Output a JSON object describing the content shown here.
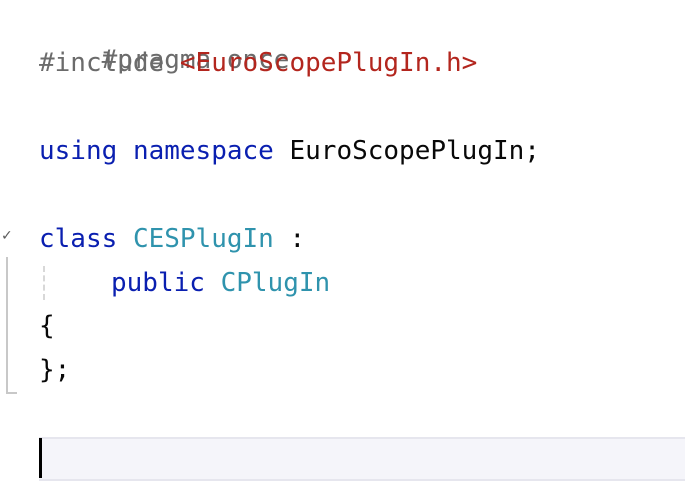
{
  "editor": {
    "lines": [
      {
        "segments": [
          {
            "text": "#pragma once"
          }
        ]
      },
      {
        "segments": [
          {
            "text": "#include "
          },
          {
            "text": "<EuroScopePlugIn.h>"
          }
        ]
      },
      {
        "segments": [
          {
            "text": "using"
          },
          {
            "text": " "
          },
          {
            "text": "namespace"
          },
          {
            "text": " EuroScopePlugIn;"
          }
        ]
      },
      {
        "segments": [
          {
            "text": "class"
          },
          {
            "text": " "
          },
          {
            "text": "CESPlugIn"
          },
          {
            "text": " :"
          }
        ]
      },
      {
        "segments": [
          {
            "text": "public"
          },
          {
            "text": " "
          },
          {
            "text": "CPlugIn"
          }
        ]
      },
      {
        "segments": [
          {
            "text": "{"
          }
        ]
      },
      {
        "segments": [
          {
            "text": "};"
          }
        ]
      }
    ]
  },
  "gutter": {
    "fold_icon": "chevron-down-icon",
    "fold_glyph": "✓"
  },
  "colors": {
    "keyword": "#0a1fb0",
    "class_name": "#2f93ad",
    "include_path": "#b3261e",
    "directive": "#6b6b6b",
    "text": "#080808"
  }
}
